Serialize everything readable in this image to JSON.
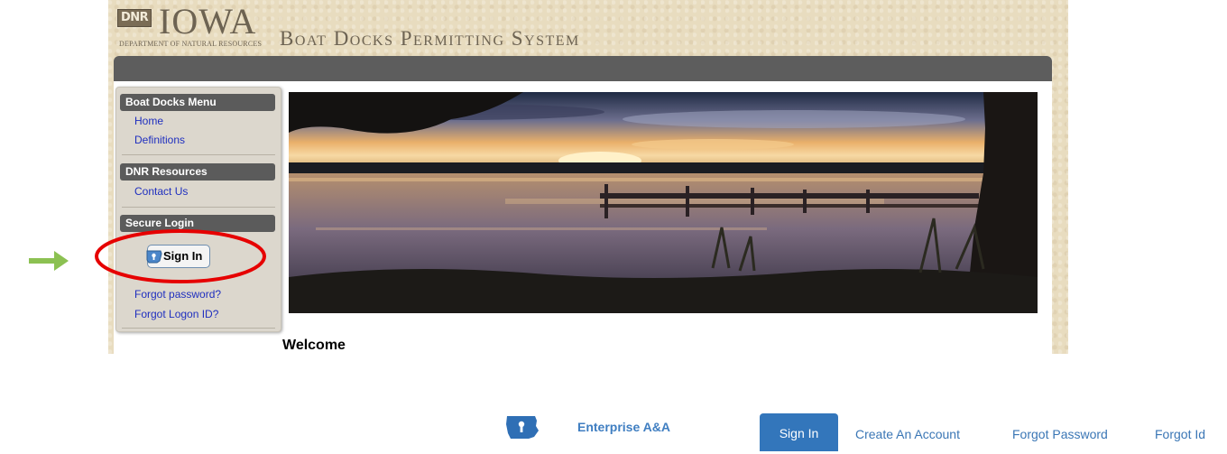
{
  "header": {
    "dnr_badge": "DNR",
    "logo_iowa": "IOWA",
    "logo_department": "DEPARTMENT OF NATURAL RESOURCES",
    "system_title": "Boat Docks Permitting System"
  },
  "sidebar": {
    "boat_docks_menu": {
      "title": "Boat Docks Menu",
      "items": [
        {
          "label": "Home"
        },
        {
          "label": "Definitions"
        }
      ]
    },
    "dnr_resources": {
      "title": "DNR Resources",
      "items": [
        {
          "label": "Contact Us"
        }
      ]
    },
    "secure_login": {
      "title": "Secure Login",
      "sign_in_label": "Sign In",
      "forgot_password": "Forgot password?",
      "forgot_logon_id": "Forgot Logon ID?"
    }
  },
  "main": {
    "hero_image": "lake-sunset-dock",
    "welcome": "Welcome"
  },
  "annotations": {
    "arrow_color": "#8cc152",
    "circle_color": "#e60000"
  },
  "enterprise_bar": {
    "logo_icon": "iowa-state-lock-icon",
    "title": "Enterprise A&A",
    "sign_in": "Sign In",
    "create_account": "Create An Account",
    "forgot_password": "Forgot Password",
    "forgot_id": "Forgot Id",
    "accent": "#3376bb"
  }
}
